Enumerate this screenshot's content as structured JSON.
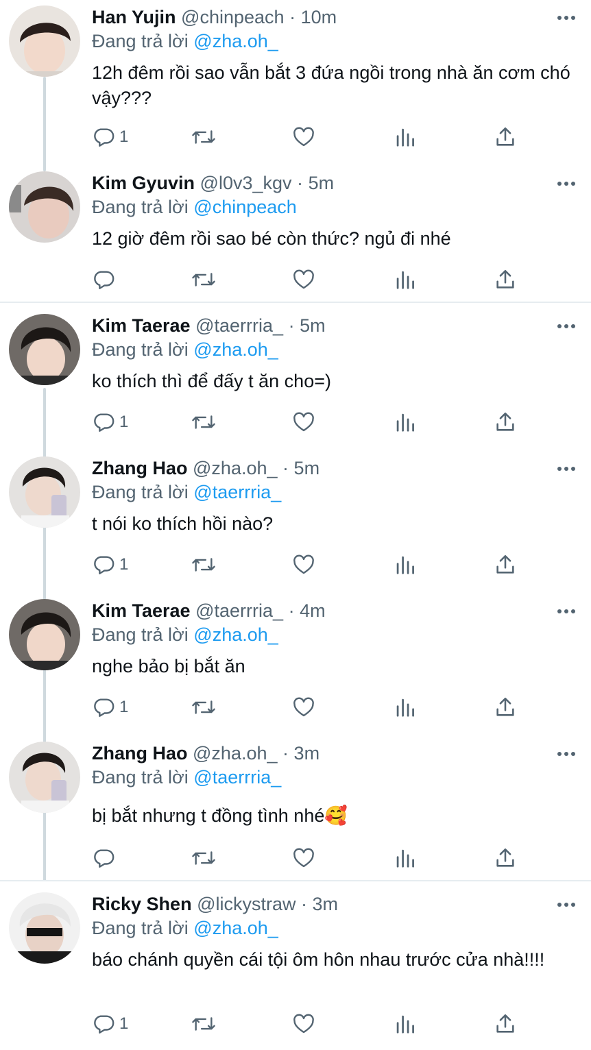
{
  "reply_prefix": "Đang trả lời",
  "tweets": [
    {
      "name": "Han Yujin",
      "handle": "@chinpeach",
      "time": "10m",
      "reply_to": "@zha.oh_",
      "text": "12h đêm rồi sao vẫn bắt 3 đứa ngồi trong nhà ăn cơm chó vậy???",
      "reply_count": "1"
    },
    {
      "name": "Kim Gyuvin",
      "handle": "@l0v3_kgv",
      "time": "5m",
      "reply_to": "@chinpeach",
      "text": "12 giờ đêm rồi sao bé còn thức? ngủ đi nhé",
      "reply_count": ""
    },
    {
      "name": "Kim Taerae",
      "handle": "@taerrria_",
      "time": "5m",
      "reply_to": "@zha.oh_",
      "text": "ko thích thì để đấy t ăn cho=)",
      "reply_count": "1"
    },
    {
      "name": "Zhang Hao",
      "handle": "@zha.oh_",
      "time": "5m",
      "reply_to": "@taerrria_",
      "text": "t nói ko thích hồi nào?",
      "reply_count": "1"
    },
    {
      "name": "Kim Taerae",
      "handle": "@taerrria_",
      "time": "4m",
      "reply_to": "@zha.oh_",
      "text": "nghe bảo bị bắt ăn",
      "reply_count": "1"
    },
    {
      "name": "Zhang Hao",
      "handle": "@zha.oh_",
      "time": "3m",
      "reply_to": "@taerrria_",
      "text": "bị bắt nhưng t đồng tình nhé🥰",
      "reply_count": ""
    },
    {
      "name": "Ricky Shen",
      "handle": "@lickystraw",
      "time": "3m",
      "reply_to": "@zha.oh_",
      "text": "báo chánh quyền cái tội ôm hôn nhau trước cửa nhà!!!!",
      "reply_count": "1"
    }
  ],
  "colors": {
    "text": "#0f1419",
    "secondary": "#536471",
    "mention": "#1d9bf0",
    "thread_line": "#cfd9de",
    "divider": "#e6ecf0"
  },
  "icons": [
    "reply-icon",
    "retweet-icon",
    "like-icon",
    "views-icon",
    "share-icon",
    "more-icon"
  ]
}
